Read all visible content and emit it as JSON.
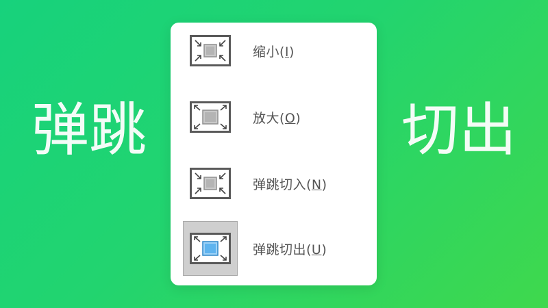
{
  "background": {
    "title_left": "弹跳",
    "title_right": "切出",
    "gradient_start": "#17d27c",
    "gradient_end": "#3fd84d"
  },
  "menu": {
    "items": [
      {
        "label": "缩小(",
        "mnemonic": "I",
        "suffix": ")",
        "icon": "shrink-icon",
        "selected": false
      },
      {
        "label": "放大(",
        "mnemonic": "O",
        "suffix": ")",
        "icon": "enlarge-icon",
        "selected": false
      },
      {
        "label": "弹跳切入(",
        "mnemonic": "N",
        "suffix": ")",
        "icon": "bounce-in-icon",
        "selected": false
      },
      {
        "label": "弹跳切出(",
        "mnemonic": "U",
        "suffix": ")",
        "icon": "bounce-out-icon",
        "selected": true
      }
    ]
  },
  "colors": {
    "icon_frame": "#5a5a5a",
    "icon_inner_gray": "#b4b4b4",
    "icon_inner_blue": "#5fb4ef",
    "selection_bg": "#cfcfcf"
  }
}
